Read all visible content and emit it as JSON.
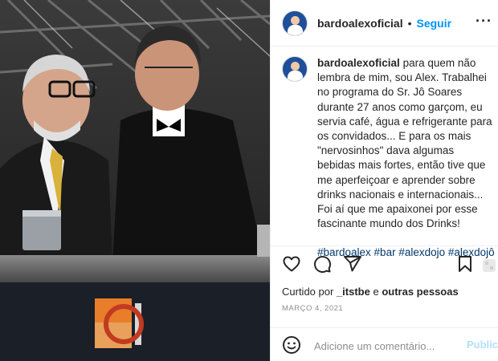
{
  "post": {
    "username": "bardoalexoficial",
    "separator": "•",
    "follow_label": "Seguir",
    "more_label": "···",
    "caption_text": "para quem não lembra de mim, sou Alex. Trabalhei no programa do Sr. Jô Soares durante 27 anos como garçom, eu servia café, água e refrigerante para os convidados... E para os mais \"nervosinhos\" dava algumas bebidas mais fortes, então tive que me aperfeiçoar e aprender sobre drinks nacionais e internacionais... Foi aí que me apaixonei por esse fascinante mundo dos Drinks!",
    "hashtags": "#bardoalex #bar #alexdojo #alexdojô",
    "likes_prefix": "Curtido por",
    "liked_by": "_itstbe",
    "likes_joiner": "e",
    "likes_others": "outras pessoas",
    "date": "MARÇO 4, 2021"
  },
  "comment": {
    "placeholder": "Adicione um comentário...",
    "post_label": "Publicar"
  },
  "icons": [
    "heart-icon",
    "comment-icon",
    "share-icon",
    "bookmark-icon",
    "emoji-icon",
    "more-options-icon"
  ],
  "colors": {
    "accent": "#0095f6",
    "hashtag": "#00376b",
    "muted": "#8e8e8e",
    "post_disabled": "#b2dffc"
  }
}
